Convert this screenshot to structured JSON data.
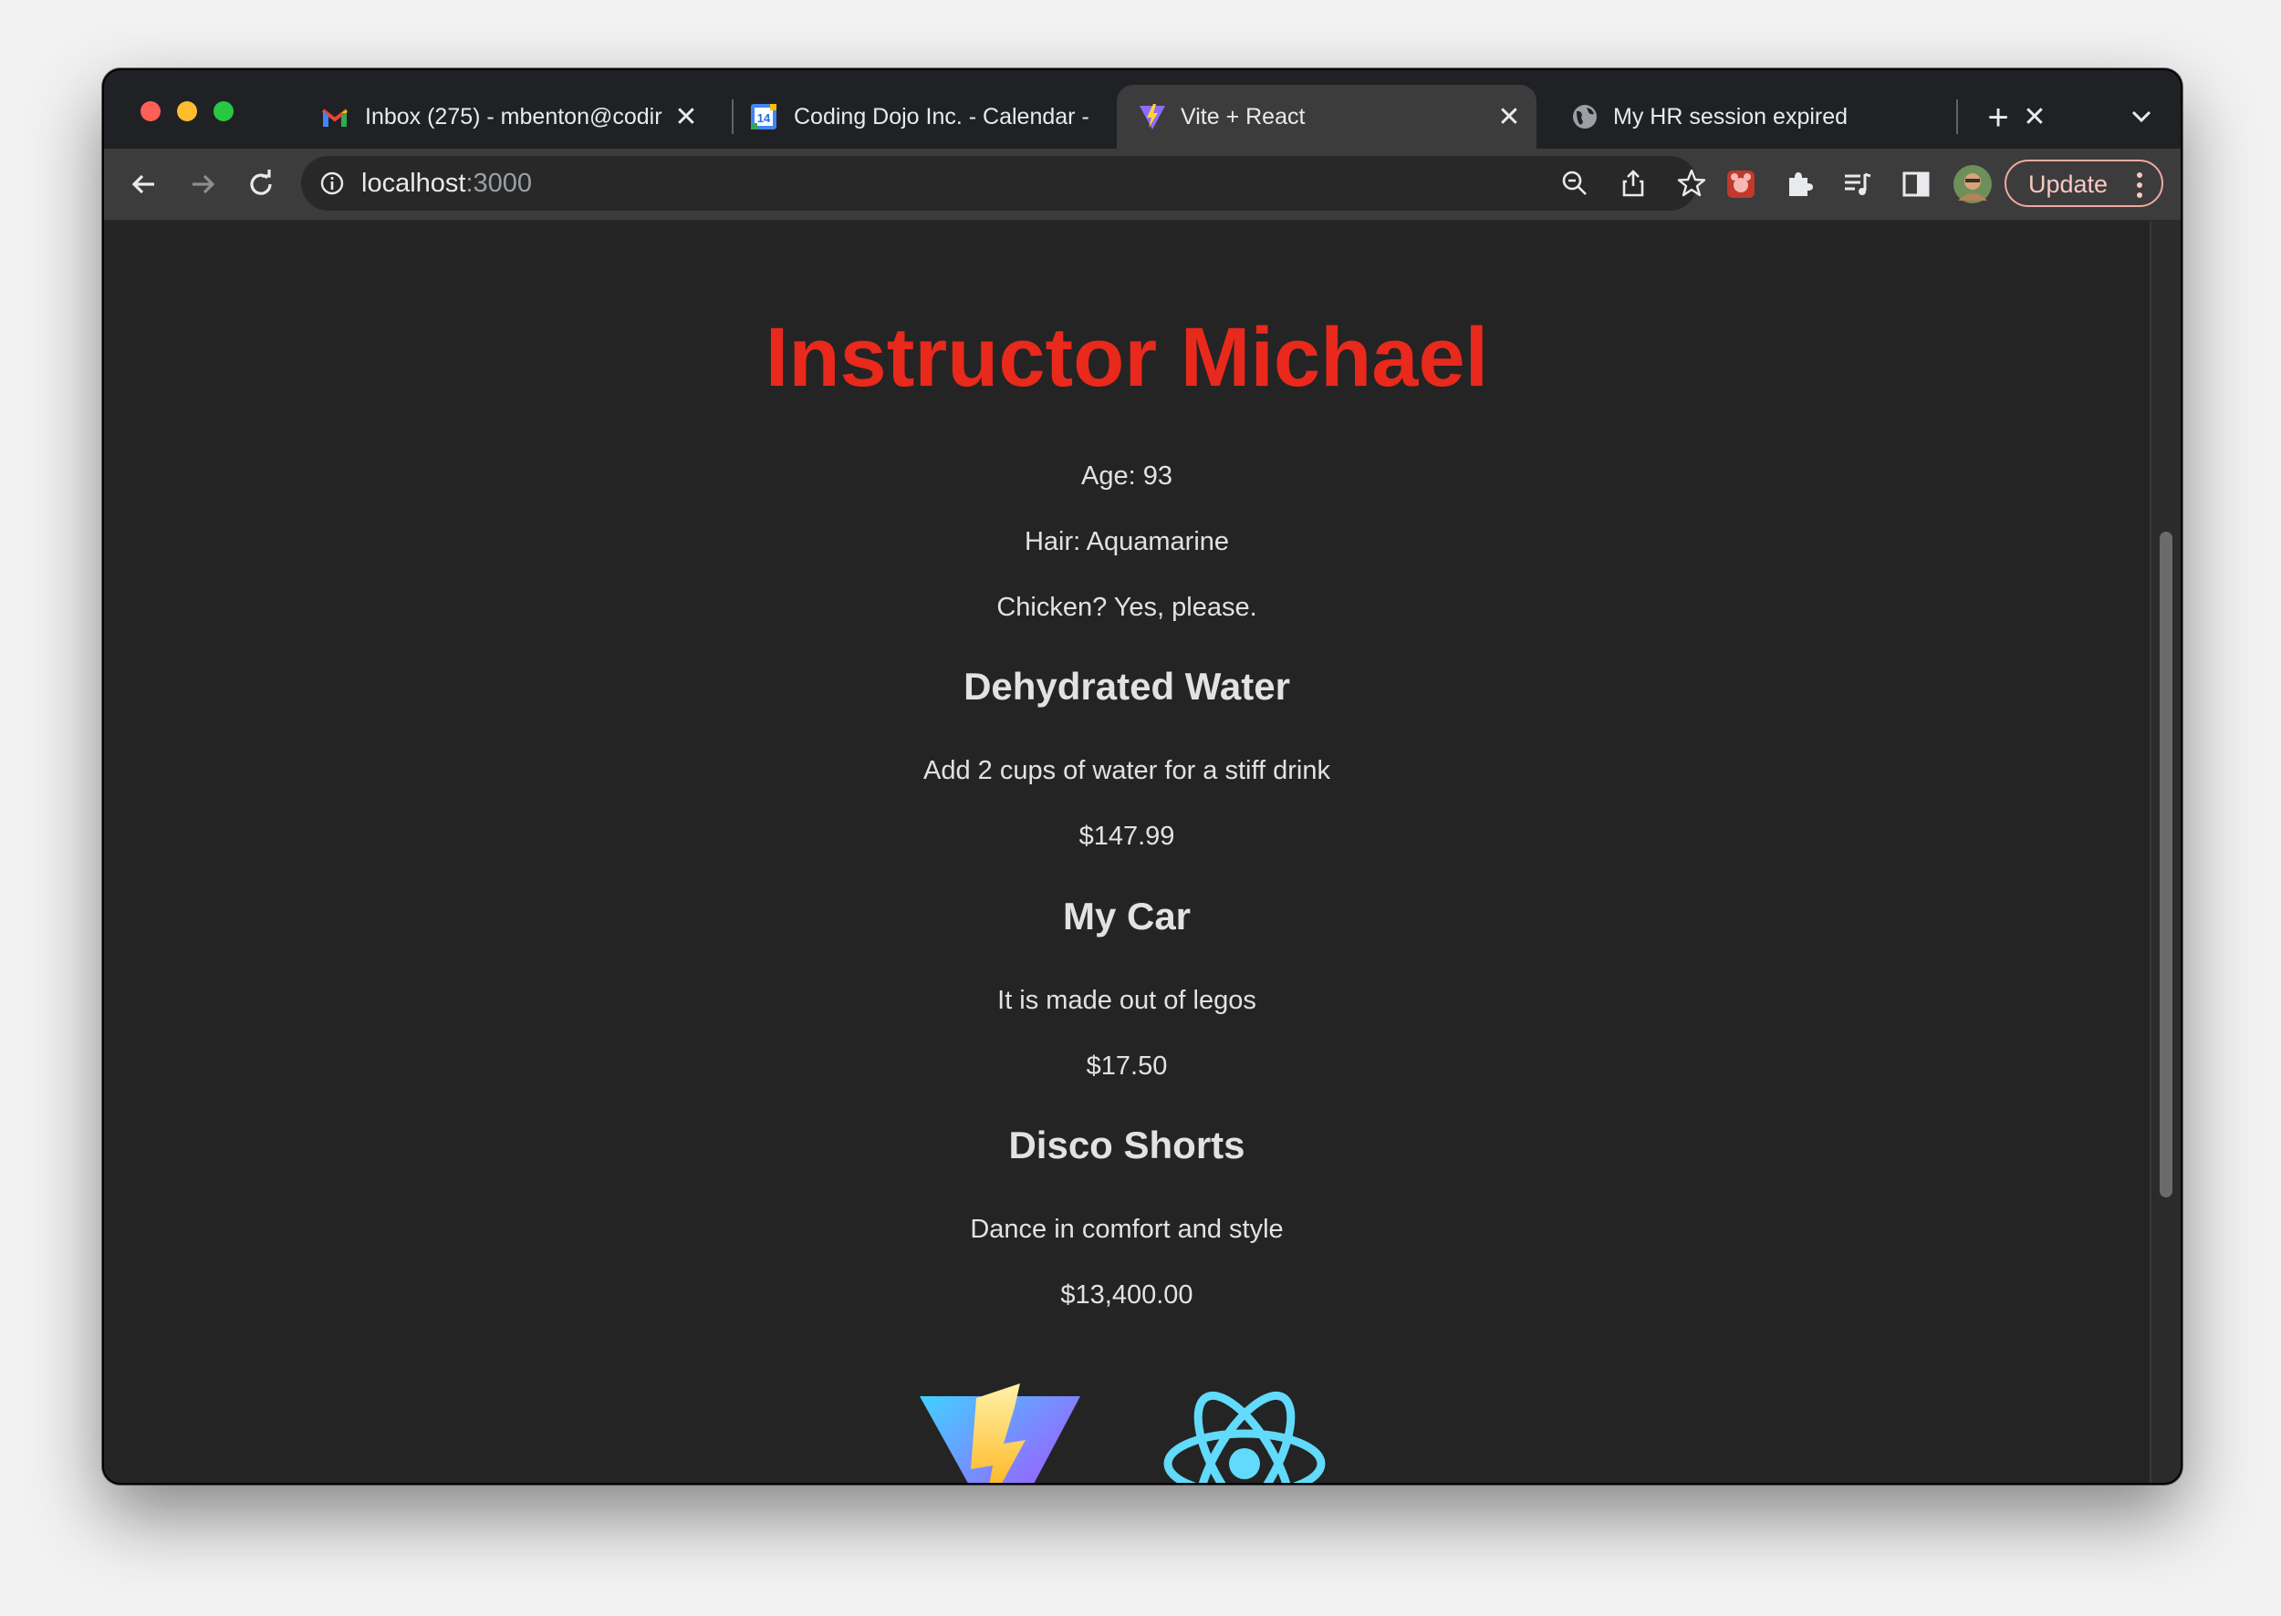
{
  "browser": {
    "tabs": [
      {
        "title": "Inbox (275) - mbenton@codir",
        "favicon": "gmail-icon",
        "active": false
      },
      {
        "title": "Coding Dojo Inc. - Calendar -",
        "favicon": "calendar-icon",
        "active": false,
        "badge": "14"
      },
      {
        "title": "Vite + React",
        "favicon": "vite-icon",
        "active": true
      },
      {
        "title": "My HR session expired",
        "favicon": "globe-icon",
        "active": false
      }
    ],
    "address": {
      "host": "localhost",
      "port": ":3000"
    },
    "update_label": "Update"
  },
  "page": {
    "heading": "Instructor Michael",
    "details": [
      "Age: 93",
      "Hair: Aquamarine",
      "Chicken? Yes, please."
    ],
    "products": [
      {
        "name": "Dehydrated Water",
        "description": "Add 2 cups of water for a stiff drink",
        "price": "$147.99"
      },
      {
        "name": "My Car",
        "description": "It is made out of legos",
        "price": "$17.50"
      },
      {
        "name": "Disco Shorts",
        "description": "Dance in comfort and style",
        "price": "$13,400.00"
      }
    ],
    "logos": [
      "vite-logo",
      "react-logo"
    ]
  },
  "colors": {
    "accent_heading": "#e8291c",
    "page_bg": "#242424",
    "vite_yellow": "#ffd62e",
    "vite_purple": "#bd34fe",
    "react_blue": "#61dafb"
  }
}
